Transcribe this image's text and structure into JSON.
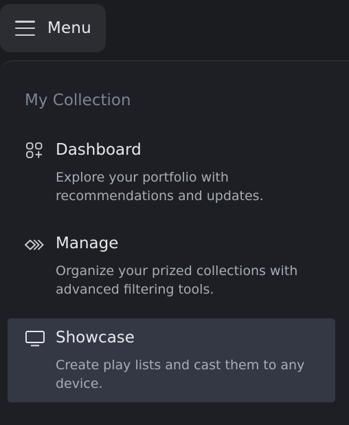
{
  "header": {
    "menu_label": "Menu",
    "menu_icon": "hamburger-icon"
  },
  "panel": {
    "section_title": "My Collection",
    "items": [
      {
        "icon": "dashboard-grid-icon",
        "title": "Dashboard",
        "description": "Explore your portfolio with recommendations and updates."
      },
      {
        "icon": "manage-chevrons-icon",
        "title": "Manage",
        "description": "Organize your prized collections with advanced filtering tools."
      },
      {
        "icon": "monitor-icon",
        "title": "Showcase",
        "description": "Create play lists and cast them to any device.",
        "selected": true
      }
    ]
  },
  "colors": {
    "background": "#1b1c20",
    "menu_button": "#2b2d33",
    "selected_item": "#343845",
    "section_title": "#7a8596",
    "text_primary": "#e6e8ec",
    "text_secondary": "#a6adb8"
  }
}
